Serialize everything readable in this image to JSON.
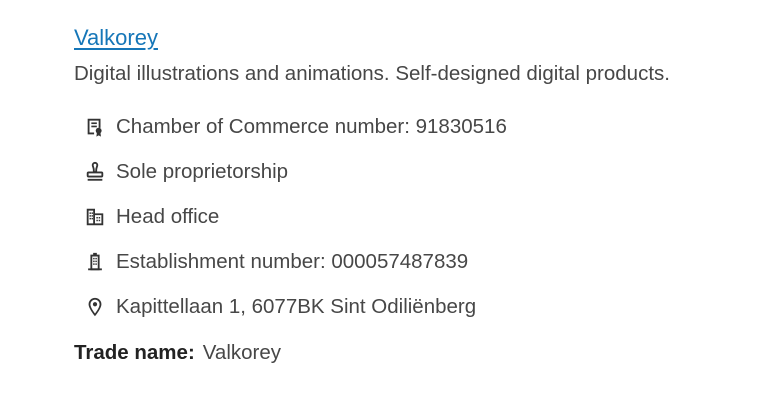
{
  "company": {
    "name": "Valkorey",
    "description": "Digital illustrations and animations. Self-designed digital products."
  },
  "details": [
    {
      "icon": "certificate-icon",
      "text": "Chamber of Commerce number: 91830516"
    },
    {
      "icon": "stamp-icon",
      "text": "Sole proprietorship"
    },
    {
      "icon": "buildings-icon",
      "text": "Head office"
    },
    {
      "icon": "building-icon",
      "text": "Establishment number: 000057487839"
    },
    {
      "icon": "location-pin-icon",
      "text": "Kapittellaan 1, 6077BK Sint Odiliënberg"
    }
  ],
  "trade": {
    "label": "Trade name:",
    "value": "Valkorey"
  },
  "colors": {
    "link": "#1576b8",
    "text": "#474747",
    "icon": "#333333"
  }
}
